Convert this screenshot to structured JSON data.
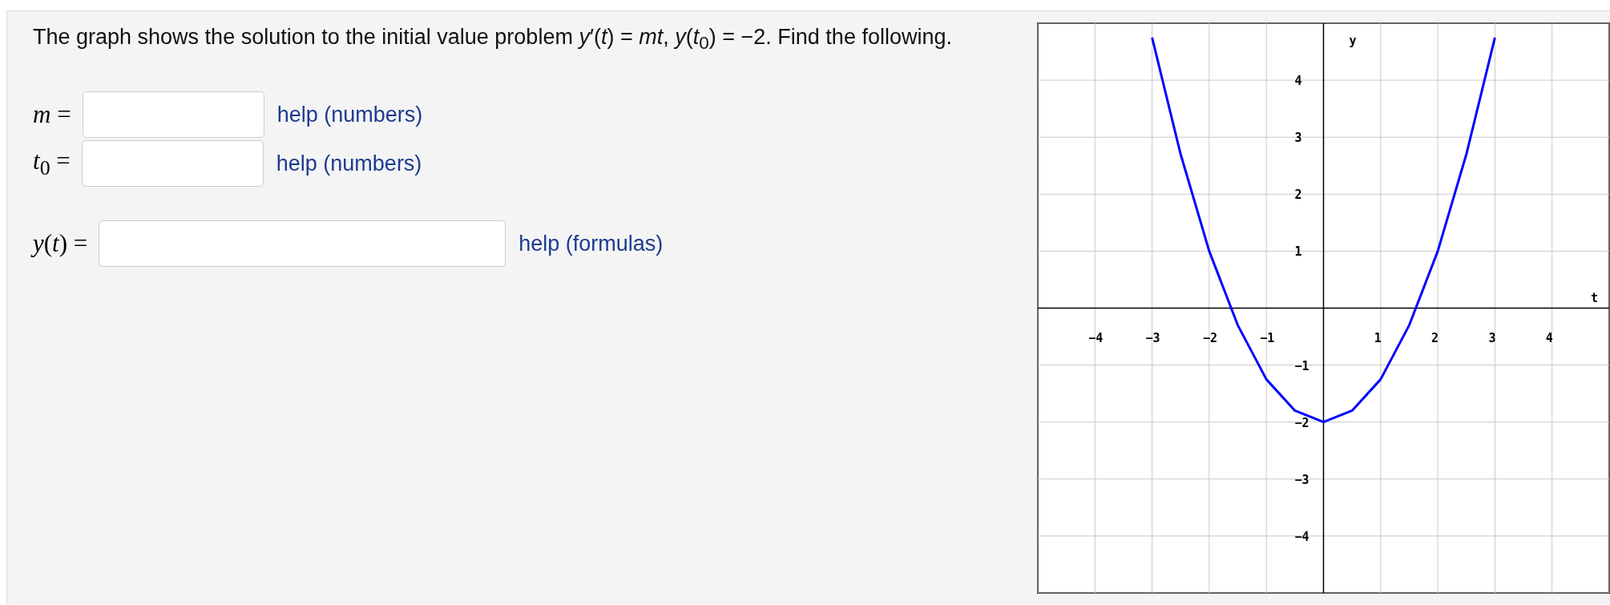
{
  "problem": {
    "prompt": "The graph shows the solution to the initial value problem *y*′(*t*) = *mt*, *y*(*t*$_{0}$) = −2. Find the following."
  },
  "answers": [
    {
      "label": "*m* =",
      "help": "help (numbers)"
    },
    {
      "label": "*t*$_{0}$ =",
      "help": "help (numbers)"
    },
    {
      "label": "*y*(*t*) =",
      "help": "help (formulas)"
    }
  ],
  "graph": {
    "chart_data": {
      "type": "line",
      "xlabel": "t",
      "ylabel": "y",
      "xlim": [
        -5,
        5
      ],
      "ylim": [
        -5,
        5
      ],
      "grid": true,
      "xticks": [
        -4,
        -3,
        -2,
        -1,
        1,
        2,
        3,
        4
      ],
      "yticks": [
        -4,
        -3,
        -2,
        -1,
        1,
        2,
        3,
        4
      ],
      "x": [
        -3,
        -2.5,
        -2,
        -1.5,
        -1,
        -0.5,
        0,
        0.5,
        1,
        1.5,
        2,
        2.5,
        3
      ],
      "series": [
        {
          "color": "#0000ff",
          "values": [
            4.75,
            2.7,
            1,
            -0.3,
            -1.25,
            -1.8,
            -2,
            -1.8,
            -1.25,
            -0.3,
            1,
            2.7,
            4.75
          ]
        }
      ]
    }
  }
}
